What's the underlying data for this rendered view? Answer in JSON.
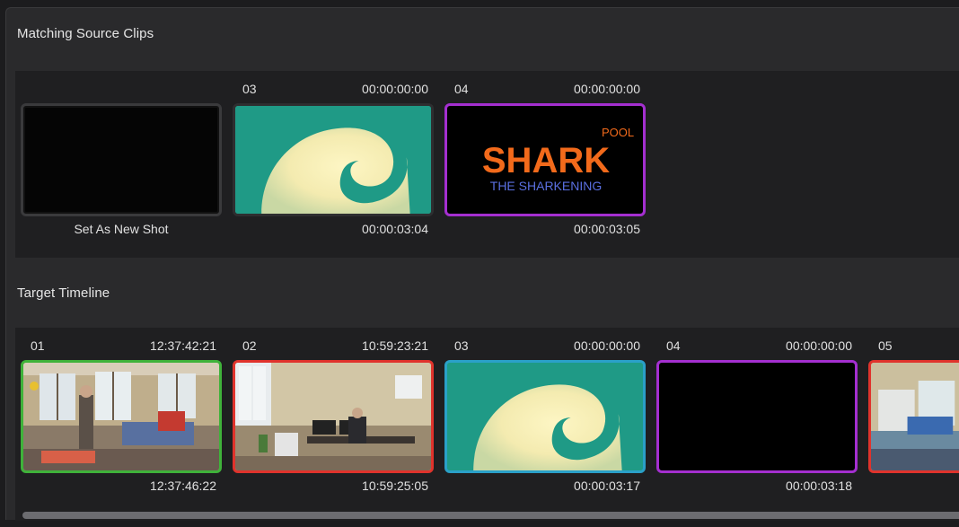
{
  "matching": {
    "title": "Matching Source Clips",
    "clips": [
      {
        "caption": "Set As New Shot"
      },
      {
        "number": "03",
        "tc_start": "00:00:00:00",
        "tc_end": "00:00:03:04"
      },
      {
        "number": "04",
        "tc_start": "00:00:00:00",
        "tc_end": "00:00:03:05",
        "title_logo": {
          "pool": "POOL",
          "shark": "SHARK",
          "sub": "THE SHARKENING"
        }
      }
    ]
  },
  "timeline": {
    "title": "Target Timeline",
    "clips": [
      {
        "number": "01",
        "tc_start": "12:37:42:21",
        "tc_end": "12:37:46:22",
        "border_color": "#3fb23a"
      },
      {
        "number": "02",
        "tc_start": "10:59:23:21",
        "tc_end": "10:59:25:05",
        "border_color": "#e0332c"
      },
      {
        "number": "03",
        "tc_start": "00:00:00:00",
        "tc_end": "00:00:03:17",
        "border_color": "#2aa0c8"
      },
      {
        "number": "04",
        "tc_start": "00:00:00:00",
        "tc_end": "00:00:03:18",
        "border_color": "#a42fd0"
      },
      {
        "number": "05",
        "border_color": "#e0332c"
      }
    ]
  },
  "colors": {
    "wave_cream": "#f7efb2",
    "wave_teal": "#1f9a86",
    "shark_orange": "#f26a1b",
    "shark_blue": "#5a6fe0",
    "selected_border": "#a42fd0"
  }
}
